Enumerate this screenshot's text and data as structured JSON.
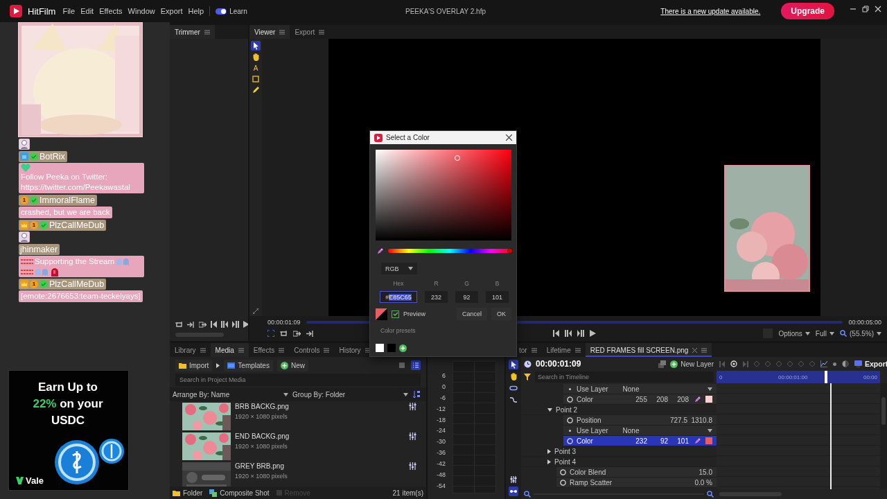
{
  "titlebar": {
    "app_name": "HitFilm",
    "menus": [
      "File",
      "Edit",
      "Effects",
      "Window",
      "Export",
      "Help"
    ],
    "learn_toggle": {
      "label": "Learn",
      "on": true
    },
    "project_title": "PEEKA'S OVERLAY 2.hfp",
    "update_link": "There is a new update available.",
    "upgrade_button": "Upgrade"
  },
  "stream_overlay": {
    "chat": [
      {
        "parts": [
          {
            "kind": "figure"
          }
        ]
      },
      {
        "user": "BotRix",
        "badges": [
          {
            "kind": "bot"
          },
          {
            "kind": "verified"
          }
        ],
        "parts": [
          {
            "kind": "heart"
          },
          {
            "kind": "text",
            "text": "Follow Peeka on Twitter: https://twitter.com/Peekawastal"
          }
        ]
      },
      {
        "user": "ImmoralFlame",
        "badges": [
          {
            "kind": "tier",
            "text": "1"
          },
          {
            "kind": "verified"
          }
        ],
        "parts": [
          {
            "kind": "text",
            "text": "crashed, but we are back"
          }
        ]
      },
      {
        "user": "PlzCallMeDub",
        "badges": [
          {
            "kind": "crown"
          },
          {
            "kind": "tier",
            "text": "1"
          },
          {
            "kind": "verified"
          }
        ],
        "parts": [
          {
            "kind": "figure"
          }
        ]
      },
      {
        "user": "jhinmaker",
        "parts": [
          {
            "kind": "stripes"
          },
          {
            "kind": "text",
            "text": "Supporting the Stream"
          },
          {
            "kind": "ghost"
          },
          {
            "kind": "stripes"
          },
          {
            "kind": "ghost"
          },
          {
            "kind": "siren"
          }
        ]
      },
      {
        "user": "PlzCallMeDub",
        "badges": [
          {
            "kind": "crown"
          },
          {
            "kind": "tier",
            "text": "1"
          },
          {
            "kind": "verified"
          }
        ],
        "parts": [
          {
            "kind": "text",
            "text": "[emote:2676653:team-teckelyays]"
          }
        ]
      }
    ],
    "ad": {
      "headline_start": "Earn Up to",
      "highlight": "22%",
      "headline_end": "on your USDC",
      "brand": "Vale"
    }
  },
  "trimmer": {
    "tab": "Trimmer"
  },
  "viewer": {
    "tabs": [
      {
        "label": "Viewer",
        "selected": true
      },
      {
        "label": "Export",
        "selected": false
      }
    ],
    "tools": [
      {
        "kind": "select",
        "selected": true
      },
      {
        "kind": "hand",
        "selected": false
      },
      {
        "kind": "text",
        "label": "A",
        "selected": false
      },
      {
        "kind": "crop",
        "selected": false
      },
      {
        "kind": "pen",
        "selected": false
      }
    ],
    "current_time": "00:00:01:09",
    "end_time": "00:00:05:00",
    "options_menu": "Options",
    "quality_menu": "Full",
    "zoom": "(55.5%)"
  },
  "color_dialog": {
    "title": "Select a Color",
    "hue": {
      "level": 0.99
    },
    "mode": "RGB",
    "labels": [
      "Hex",
      "R",
      "G",
      "B"
    ],
    "hex": {
      "prefix": "#",
      "value": "E85C65",
      "selected": true
    },
    "channels": [
      "232",
      "92",
      "101"
    ],
    "preview": {
      "label": "Preview",
      "checked": true
    },
    "buttons": [
      "Cancel",
      "OK"
    ],
    "presets_label": "Color presets",
    "presets": [
      {
        "color": "#ffffff"
      },
      {
        "color": "#000000"
      }
    ]
  },
  "media_panel": {
    "tabs": [
      {
        "label": "Library",
        "selected": false
      },
      {
        "label": "Media",
        "selected": true
      },
      {
        "label": "Effects",
        "selected": false
      },
      {
        "label": "Controls",
        "selected": false
      },
      {
        "label": "History",
        "selected": false
      }
    ],
    "import": "Import",
    "templates": "Templates",
    "new": "New",
    "view_modes": [
      {
        "kind": "grid",
        "selected": false
      },
      {
        "kind": "list",
        "selected": true
      }
    ],
    "search_placeholder": "Search in Project Media",
    "arrange_by": "Arrange By: Name",
    "group_by": "Group By: Folder",
    "items": [
      {
        "name": "BRB BACKG.png",
        "size": "1920 × 1080 pixels"
      },
      {
        "name": "END BACKG.png",
        "size": "1920 × 1080 pixels"
      },
      {
        "name": "GREY BRB.png",
        "size": "1920 × 1080 pixels"
      }
    ],
    "footer": {
      "folder": "Folder",
      "composite_shot": "Composite Shot",
      "remove": {
        "label": "Remove",
        "disabled": true
      },
      "count": "21 item(s)"
    }
  },
  "meter_scale": [
    "6",
    "0",
    "-6",
    "-12",
    "-18",
    "-24",
    "-30",
    "-36",
    "-42",
    "-48",
    "-54"
  ],
  "timeline": {
    "tabs": [
      {
        "label": "tor",
        "selected": false,
        "closable": false
      },
      {
        "label": "Lifetime",
        "selected": false,
        "closable": false
      },
      {
        "label": "RED FRAMES fill SCREEN.png",
        "selected": true,
        "closable": true
      }
    ],
    "tools": [
      {
        "kind": "select",
        "selected": true
      },
      {
        "kind": "hand",
        "selected": false
      },
      {
        "kind": "slip",
        "selected": false
      },
      {
        "kind": "curve",
        "selected": false
      }
    ],
    "bottom_tools": [
      {
        "kind": "mixer",
        "selected": false
      },
      {
        "kind": "link",
        "selected": true
      }
    ],
    "current_time": "00:00:01:09",
    "new_layer": "New Layer",
    "export": "Export",
    "search_placeholder": "Search in Timeline",
    "ruler": [
      "0",
      "00:00:01:00",
      "00:00"
    ],
    "playhead": {
      "level": 0.67
    },
    "tracks": [
      {
        "kind": "continued",
        "children": [
          {
            "kind": "dropdown",
            "label": "Use Layer",
            "value": "None",
            "selected": false
          },
          {
            "kind": "color",
            "label": "Color",
            "values": [
              "255",
              "208",
              "208"
            ],
            "color": "#ffd0d0",
            "selected": false
          }
        ]
      },
      {
        "kind": "group",
        "label": "Point 2",
        "expanded": true,
        "children": [
          {
            "kind": "values",
            "label": "Position",
            "values": [
              "727.5",
              "1310.8"
            ],
            "selected": false
          },
          {
            "kind": "dropdown",
            "label": "Use Layer",
            "value": "None",
            "selected": false
          },
          {
            "kind": "color",
            "label": "Color",
            "values": [
              "232",
              "92",
              "101"
            ],
            "color": "#e85c65",
            "selected": true
          }
        ]
      },
      {
        "kind": "group",
        "label": "Point 3",
        "expanded": false
      },
      {
        "kind": "group",
        "label": "Point 4",
        "expanded": false
      },
      {
        "kind": "values",
        "label": "Color Blend",
        "values": [
          "15.0"
        ],
        "selected": false
      },
      {
        "kind": "values",
        "label": "Ramp Scatter",
        "values": [
          "0.0 %"
        ],
        "selected": false
      }
    ]
  }
}
